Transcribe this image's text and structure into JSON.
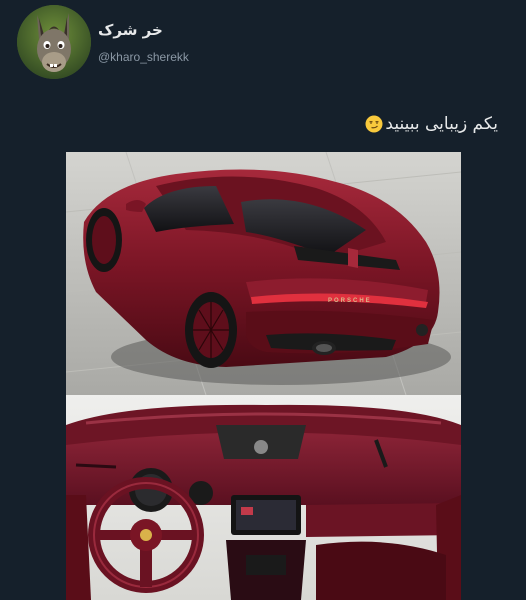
{
  "author": {
    "display_name": "خر شرک",
    "handle": "@kharo_sherekk",
    "avatar_icon": "donkey-avatar-icon"
  },
  "tweet": {
    "text": "یکم زیبایی ببینید",
    "emoji_icon": "smirk-face-emoji-icon"
  },
  "media": {
    "images": [
      {
        "subject": "car-rear-view",
        "plate_text": "PORSCHE"
      },
      {
        "subject": "car-interior-dashboard"
      }
    ]
  },
  "colors": {
    "background": "#15202b",
    "primary_text": "#e7e9ea",
    "secondary_text": "#8b98a5",
    "car_red": "#7a1525"
  }
}
